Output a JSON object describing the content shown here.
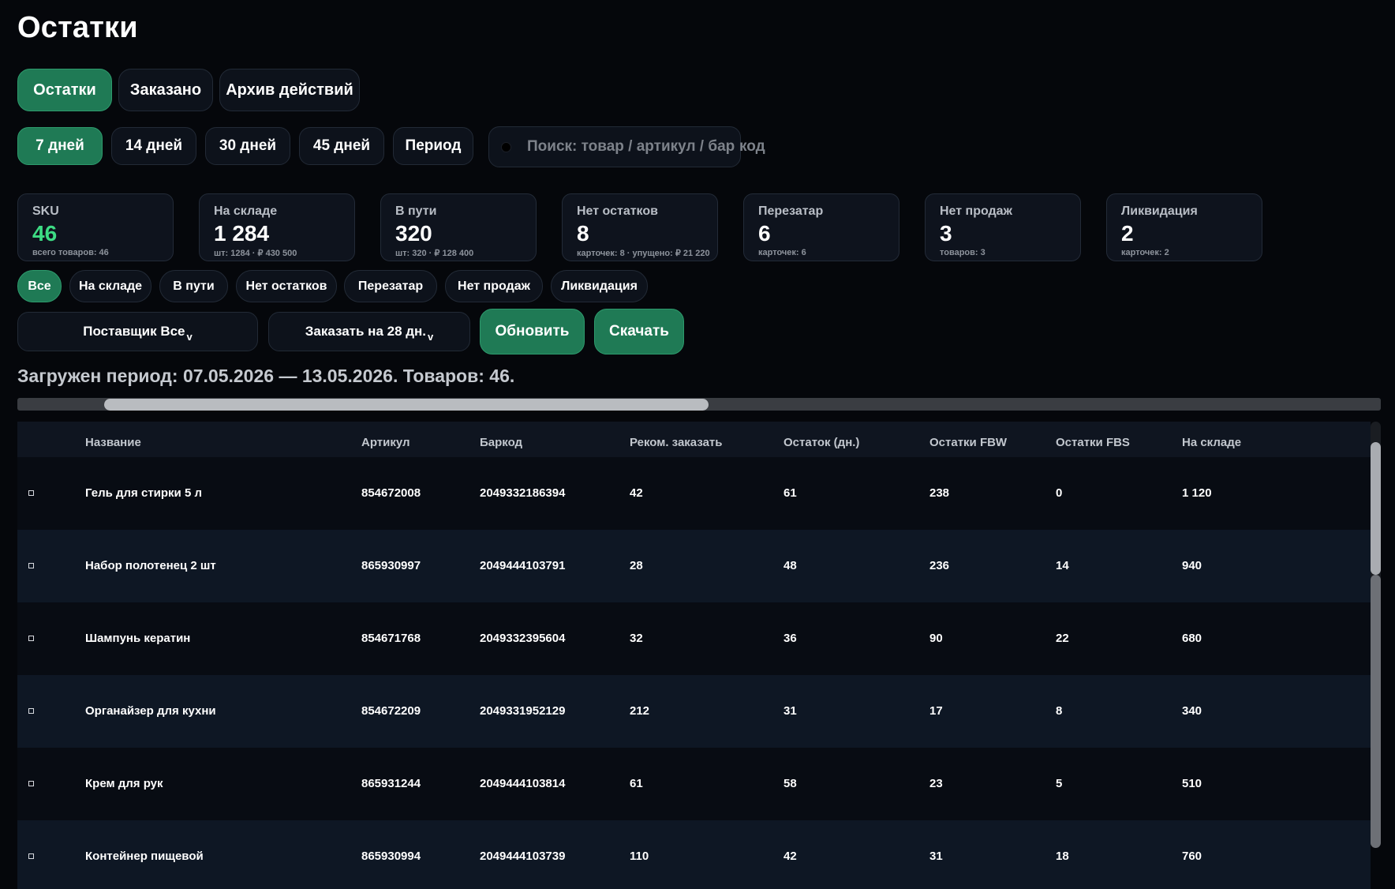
{
  "page": {
    "title": "Остатки"
  },
  "tabs": [
    {
      "label": "Остатки",
      "active": true
    },
    {
      "label": "Заказано",
      "active": false
    },
    {
      "label": "Архив действий",
      "active": false
    }
  ],
  "periods": [
    {
      "label": "7 дней",
      "active": true
    },
    {
      "label": "14 дней",
      "active": false
    },
    {
      "label": "30 дней",
      "active": false
    },
    {
      "label": "45 дней",
      "active": false
    },
    {
      "label": "Период",
      "active": false
    }
  ],
  "search": {
    "placeholder_visible": "Поиск: товар / артикул / бар",
    "placeholder_overflow": "код"
  },
  "kpis": [
    {
      "label": "SKU",
      "value": "46",
      "sub": "всего товаров: 46"
    },
    {
      "label": "На складе",
      "value": "1 284",
      "sub": "шт: 1284 · ₽ 430 500"
    },
    {
      "label": "В пути",
      "value": "320",
      "sub": "шт: 320 · ₽ 128 400"
    },
    {
      "label": "Нет остатков",
      "value": "8",
      "sub": "карточек: 8 · упущено: ₽ 21 220"
    },
    {
      "label": "Перезатар",
      "value": "6",
      "sub": "карточек: 6"
    },
    {
      "label": "Нет продаж",
      "value": "3",
      "sub": "товаров: 3"
    },
    {
      "label": "Ликвидация",
      "value": "2",
      "sub": "карточек: 2"
    }
  ],
  "filters": [
    {
      "label": "Все",
      "active": true
    },
    {
      "label": "На складе",
      "active": false
    },
    {
      "label": "В пути",
      "active": false
    },
    {
      "label": "Нет остатков",
      "active": false
    },
    {
      "label": "Перезатар",
      "active": false
    },
    {
      "label": "Нет продаж",
      "active": false
    },
    {
      "label": "Ликвидация",
      "active": false
    }
  ],
  "controls": {
    "supplier_select": "Поставщик Все",
    "order_select": "Заказать на 28 дн.",
    "caret": "v",
    "refresh": "Обновить",
    "download": "Скачать"
  },
  "status": {
    "period_text": "Загружен период: 07.05.2026 — 13.05.2026. Товаров: 46."
  },
  "colors": {
    "accent": "#1f7a55",
    "kpi_green": "#3ddc84",
    "background": "#05070b"
  },
  "table": {
    "columns": [
      "Название",
      "Артикул",
      "Баркод",
      "Реком. заказать",
      "Остаток (дн.)",
      "Остатки FBW",
      "Остатки FBS",
      "На складе"
    ],
    "rows": [
      [
        "Гель для стирки 5 л",
        "854672008",
        "2049332186394",
        "42",
        "61",
        "238",
        "0",
        "1 120"
      ],
      [
        "Набор полотенец 2 шт",
        "865930997",
        "2049444103791",
        "28",
        "48",
        "236",
        "14",
        "940"
      ],
      [
        "Шампунь кератин",
        "854671768",
        "2049332395604",
        "32",
        "36",
        "90",
        "22",
        "680"
      ],
      [
        "Органайзер для кухни",
        "854672209",
        "2049331952129",
        "212",
        "31",
        "17",
        "8",
        "340"
      ],
      [
        "Крем для рук",
        "865931244",
        "2049444103814",
        "61",
        "58",
        "23",
        "5",
        "510"
      ],
      [
        "Контейнер пищевой",
        "865930994",
        "2049444103739",
        "110",
        "42",
        "31",
        "18",
        "760"
      ]
    ]
  }
}
